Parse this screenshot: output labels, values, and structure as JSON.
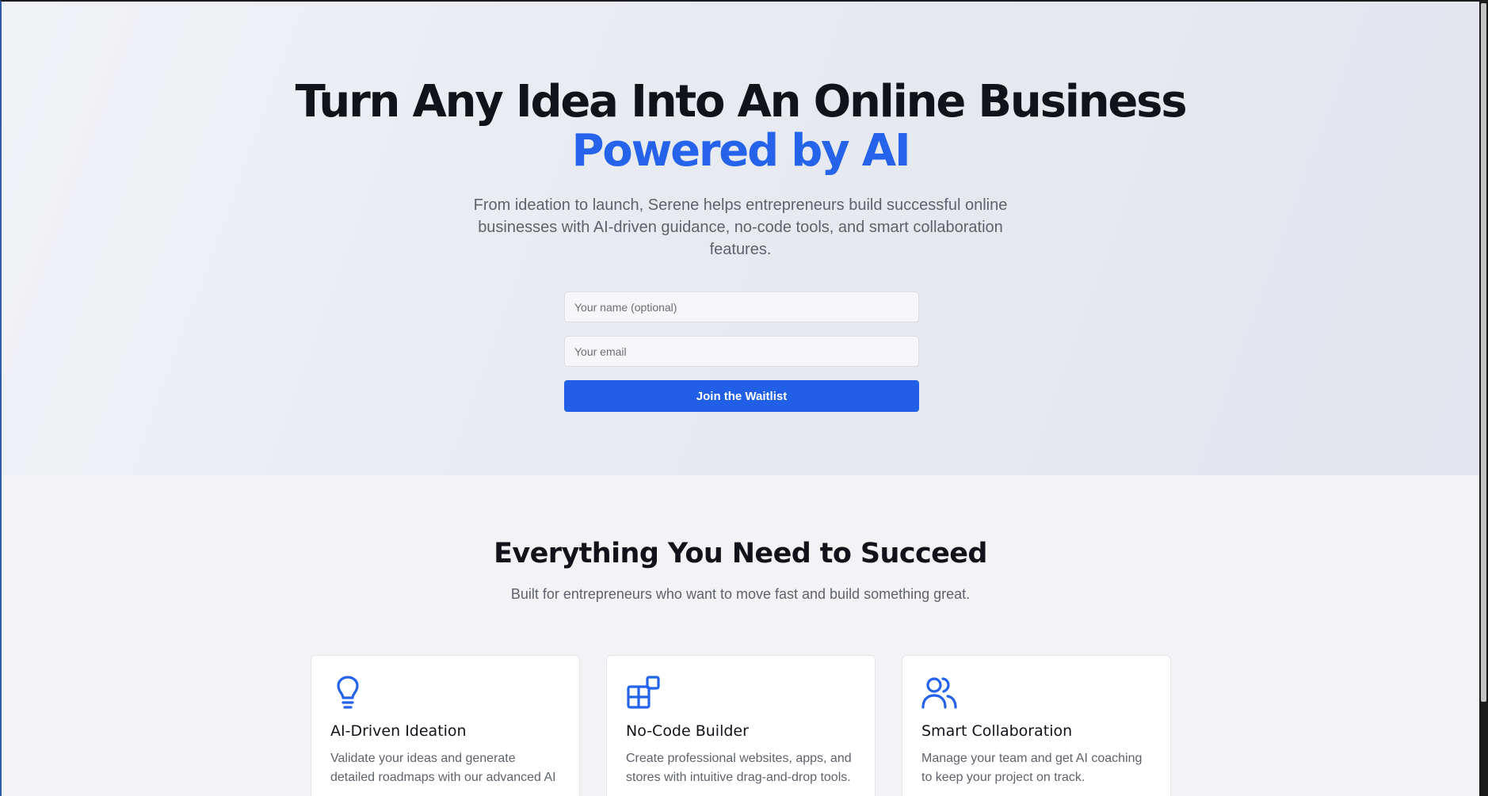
{
  "hero": {
    "title_line1": "Turn Any Idea Into An Online Business",
    "title_line2": "Powered by AI",
    "subtitle": "From ideation to launch, Serene helps entrepreneurs build successful online businesses with AI-driven guidance, no-code tools, and smart collaboration features.",
    "form": {
      "name_placeholder": "Your name (optional)",
      "email_placeholder": "Your email",
      "submit_label": "Join the Waitlist"
    }
  },
  "features": {
    "title": "Everything You Need to Succeed",
    "subtitle": "Built for entrepreneurs who want to move fast and build something great.",
    "cards": [
      {
        "icon": "lightbulb-icon",
        "title": "AI-Driven Ideation",
        "description": "Validate your ideas and generate detailed roadmaps with our advanced AI"
      },
      {
        "icon": "blocks-icon",
        "title": "No-Code Builder",
        "description": "Create professional websites, apps, and stores with intuitive drag-and-drop tools."
      },
      {
        "icon": "users-icon",
        "title": "Smart Collaboration",
        "description": "Manage your team and get AI coaching to keep your project on track."
      }
    ]
  },
  "colors": {
    "accent": "#2563eb",
    "button": "#2160e6",
    "heading": "#12131a",
    "muted_text": "#5f626d"
  }
}
